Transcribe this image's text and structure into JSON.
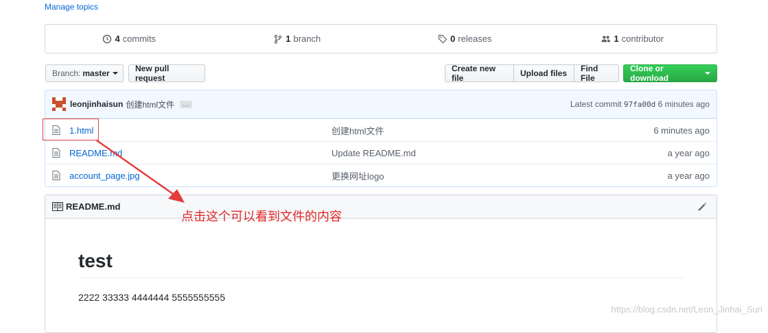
{
  "topics": {
    "manage_label": "Manage topics"
  },
  "summary": [
    {
      "icon": "history-icon",
      "count": "4",
      "label": "commits"
    },
    {
      "icon": "branch-icon",
      "count": "1",
      "label": "branch"
    },
    {
      "icon": "tag-icon",
      "count": "0",
      "label": "releases"
    },
    {
      "icon": "people-icon",
      "count": "1",
      "label": "contributor"
    }
  ],
  "toolbar": {
    "branch_prefix": "Branch:",
    "branch_name": "master",
    "new_pull_request": "New pull request",
    "create_new_file": "Create new file",
    "upload_files": "Upload files",
    "find_file": "Find File",
    "clone_or_download": "Clone or download"
  },
  "commit": {
    "author": "leonjinhaisun",
    "message": "创建html文件",
    "more": "…",
    "latest_label": "Latest commit",
    "sha": "97fa00d",
    "age": "6 minutes ago"
  },
  "files": [
    {
      "name": "1.html",
      "message": "创建html文件",
      "age": "6 minutes ago"
    },
    {
      "name": "README.md",
      "message": "Update README.md",
      "age": "a year ago"
    },
    {
      "name": "account_page.jpg",
      "message": "更换网址logo",
      "age": "a year ago"
    }
  ],
  "readme": {
    "filename": "README.md",
    "title": "test",
    "body": "2222 33333 4444444 5555555555"
  },
  "annotation": {
    "text": "点击这个可以看到文件的内容"
  },
  "watermark": "https://blog.csdn.net/Leon_Jinhai_Sun",
  "colors": {
    "accent": "#0366d6",
    "green": "#28a745",
    "annotation": "#e32727"
  }
}
